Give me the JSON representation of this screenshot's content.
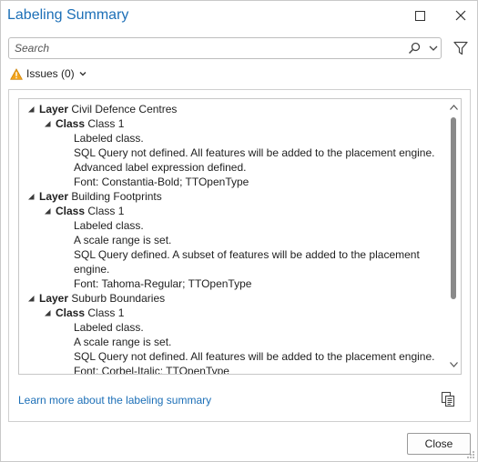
{
  "window": {
    "title": "Labeling Summary"
  },
  "search": {
    "placeholder": "Search"
  },
  "issues": {
    "label": "Issues (0)"
  },
  "tree": [
    {
      "level": 0,
      "keyword": "Layer",
      "text": "Civil Defence Centres"
    },
    {
      "level": 1,
      "keyword": "Class",
      "text": "Class 1"
    },
    {
      "level": 2,
      "text": "Labeled class."
    },
    {
      "level": 2,
      "text": "SQL Query not defined. All features will be added to the placement engine."
    },
    {
      "level": 2,
      "text": "Advanced label expression defined."
    },
    {
      "level": 2,
      "text": "Font: Constantia-Bold; TTOpenType"
    },
    {
      "level": 0,
      "keyword": "Layer",
      "text": "Building Footprints"
    },
    {
      "level": 1,
      "keyword": "Class",
      "text": "Class 1"
    },
    {
      "level": 2,
      "text": "Labeled class."
    },
    {
      "level": 2,
      "text": "A scale range is set."
    },
    {
      "level": 2,
      "text": "SQL Query defined. A subset of features will be added to the placement"
    },
    {
      "level": 2,
      "text": "engine."
    },
    {
      "level": 2,
      "text": "Font: Tahoma-Regular; TTOpenType"
    },
    {
      "level": 0,
      "keyword": "Layer",
      "text": "Suburb Boundaries"
    },
    {
      "level": 1,
      "keyword": "Class",
      "text": "Class 1"
    },
    {
      "level": 2,
      "text": "Labeled class."
    },
    {
      "level": 2,
      "text": "A scale range is set."
    },
    {
      "level": 2,
      "text": "SQL Query not defined. All features will be added to the placement engine."
    },
    {
      "level": 2,
      "text": "Font: Corbel-Italic; TTOpenType"
    }
  ],
  "footer": {
    "learn_more": "Learn more about the labeling summary"
  },
  "buttons": {
    "close": "Close"
  },
  "colors": {
    "accent": "#1c6fb7",
    "warning": "#f2a31b"
  },
  "icons": {
    "maximize": "maximize-icon",
    "close": "close-icon",
    "search": "search-icon",
    "dropdown": "chevron-down-icon",
    "filter": "filter-icon",
    "warning": "warning-icon",
    "copy": "copy-icon"
  }
}
